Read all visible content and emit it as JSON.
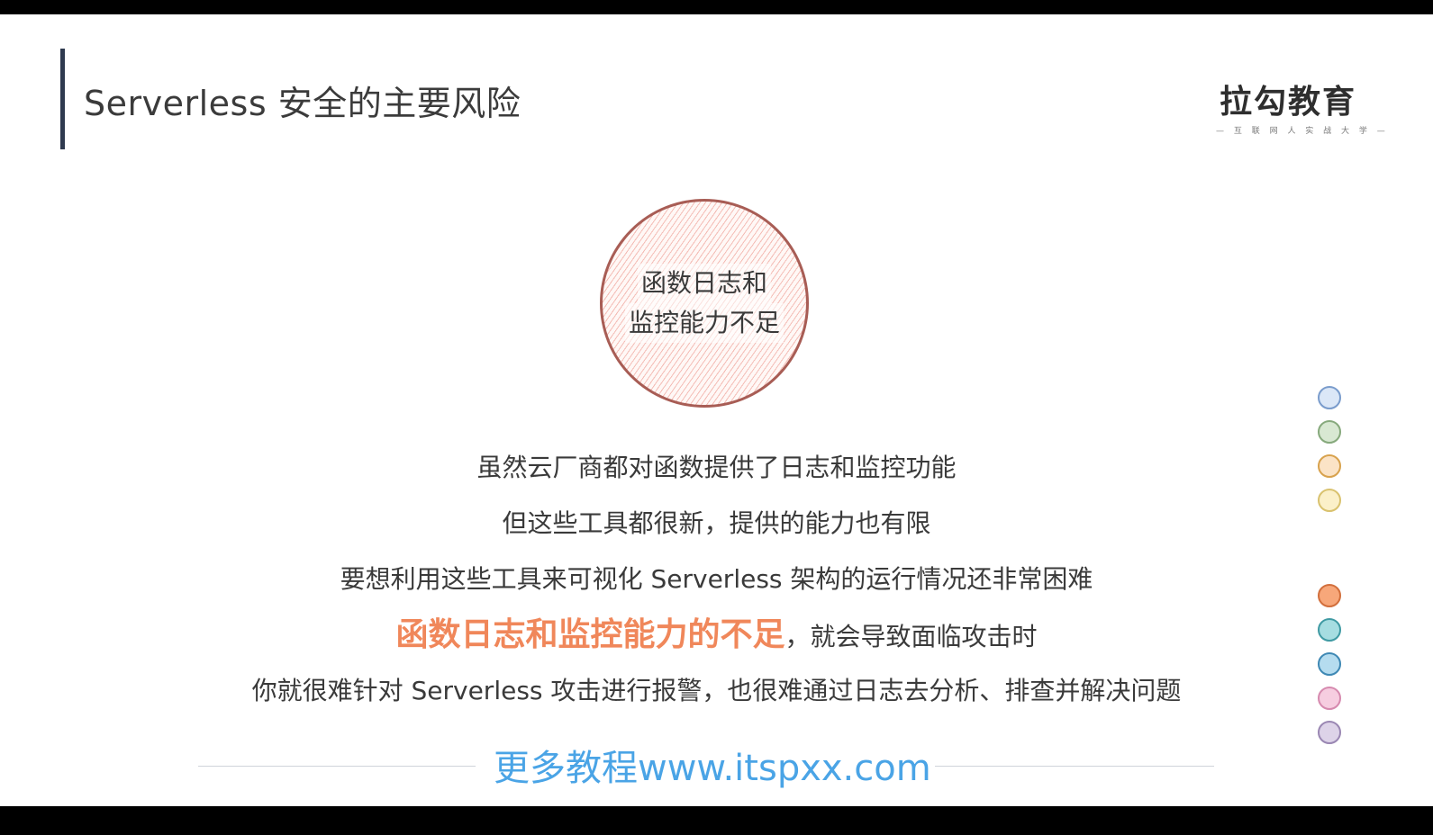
{
  "title": "Serverless 安全的主要风险",
  "logo": {
    "name": "拉勾教育",
    "tagline": "— 互 联 网 人 实 战 大 学 —"
  },
  "circle": {
    "line1": "函数日志和",
    "line2": "监控能力不足"
  },
  "body": {
    "line1": "虽然云厂商都对函数提供了日志和监控功能",
    "line2": "但这些工具都很新，提供的能力也有限",
    "line3": "要想利用这些工具来可视化 Serverless 架构的运行情况还非常困难",
    "line4_highlight": "函数日志和监控能力的不足",
    "line4_rest": "，就会导致面临攻击时",
    "line5": "你就很难针对 Serverless 攻击进行报警，也很难通过日志去分析、排查并解决问题"
  },
  "footer": {
    "text": "更多教程www.itspxx.com"
  },
  "colors": {
    "accent": "#f0875a",
    "title_bar": "#2f3a4f",
    "footer_link": "#4aa4e6",
    "circle_border": "#a85d55"
  },
  "nav_dots": [
    {
      "fill": "#dbe7f7",
      "border": "#7a9ccc"
    },
    {
      "fill": "#d8e8d2",
      "border": "#86a97c"
    },
    {
      "fill": "#fbe3c6",
      "border": "#d8a24d"
    },
    {
      "fill": "#fbf0c9",
      "border": "#d9c26e"
    },
    {
      "fill": "#f7a77a",
      "border": "#d26f3c"
    },
    {
      "fill": "#a6dde1",
      "border": "#3f9aa3"
    },
    {
      "fill": "#b5dcef",
      "border": "#3e88b4"
    },
    {
      "fill": "#f6cde0",
      "border": "#d68aaf"
    },
    {
      "fill": "#ddd3e8",
      "border": "#9a87b3"
    }
  ]
}
